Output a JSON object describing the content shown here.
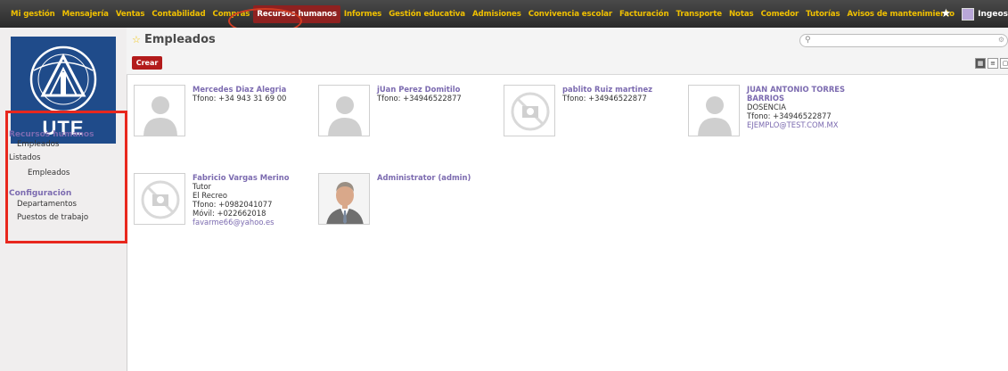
{
  "topmenu": {
    "items": [
      "Mi gestión",
      "Mensajería",
      "Ventas",
      "Contabilidad",
      "Compras",
      "Recursos humanos",
      "Informes",
      "Gestión educativa",
      "Admisiones",
      "Convivencia escolar",
      "Facturación",
      "Transporte",
      "Notas",
      "Comedor",
      "Tutorías",
      "Avisos de mantenimiento"
    ],
    "active_index": 5,
    "user_name": "Ingeos"
  },
  "logo": {
    "text": "UTE"
  },
  "sidebar": {
    "heading_hr": "Recursos humanos",
    "item_empleados": "Empleados",
    "item_listados": "Listados",
    "item_listados_empleados": "Empleados",
    "heading_config": "Configuración",
    "item_departamentos": "Departamentos",
    "item_puestos": "Puestos de trabajo"
  },
  "header": {
    "title": "Empleados",
    "create_label": "Crear"
  },
  "employees": [
    {
      "name": "Mercedes Diaz Alegria",
      "lines": [
        "Tfono: +34 943 31 69 00"
      ],
      "email": ""
    },
    {
      "name": "jUan Perez Domitilo",
      "lines": [
        "Tfono: +34946522877"
      ],
      "email": ""
    },
    {
      "name": "pablito Ruiz martinez",
      "lines": [
        "Tfono: +34946522877"
      ],
      "email": ""
    },
    {
      "name": "JUAN ANTONIO TORRES BARRIOS",
      "lines": [
        "DOSENCIA",
        "Tfono: +34946522877"
      ],
      "email": "EJEMPLO@TEST.COM.MX"
    },
    {
      "name": "Fabricio Vargas Merino",
      "lines": [
        "Tutor",
        "El Recreo",
        "Tfono: +0982041077",
        "Móvil: +022662018"
      ],
      "email": "favarme66@yahoo.es"
    },
    {
      "name": "Administrator (admin)",
      "lines": [],
      "email": ""
    }
  ],
  "colors": {
    "topbar": "#333333",
    "menu_text": "#f0c000",
    "active_menu": "#8f2120",
    "link_purple": "#7c6bb0",
    "create_button": "#b31b1b",
    "annotation_red": "#e8271d"
  }
}
